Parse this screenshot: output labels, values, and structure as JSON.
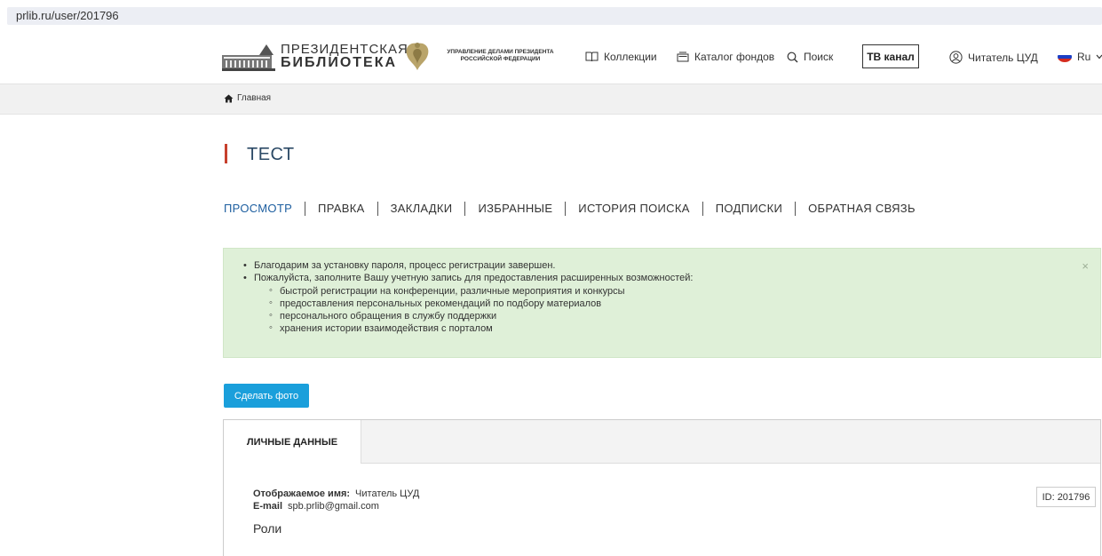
{
  "browser": {
    "url": "prlib.ru/user/201796"
  },
  "header": {
    "logo_line1": "ПРЕЗИДЕНТСКАЯ",
    "logo_line2": "БИБЛИОТЕКА",
    "admin_line1": "УПРАВЛЕНИЕ ДЕЛАМИ ПРЕЗИДЕНТА",
    "admin_line2": "РОССИЙСКОЙ ФЕДЕРАЦИИ",
    "nav": {
      "collections": "Коллекции",
      "catalog": "Каталог фондов",
      "search": "Поиск",
      "tv": "ТВ канал",
      "user": "Читатель ЦУД",
      "lang": "Ru"
    }
  },
  "breadcrumb": {
    "home": "Главная"
  },
  "page": {
    "title": "ТЕСТ"
  },
  "tabs": [
    "ПРОСМОТР",
    "ПРАВКА",
    "ЗАКЛАДКИ",
    "ИЗБРАННЫЕ",
    "ИСТОРИЯ ПОИСКА",
    "ПОДПИСКИ",
    "ОБРАТНАЯ СВЯЗЬ"
  ],
  "alert": {
    "items": [
      "Благодарим за установку пароля, процесс регистрации завершен.",
      "Пожалуйста, заполните Вашу учетную запись для предоставления расширенных возможностей:"
    ],
    "subitems": [
      "быстрой регистрации на конференции, различные мероприятия и конкурсы",
      "предоставления персональных рекомендаций по подбору материалов",
      "персонального обращения в службу поддержки",
      "хранения истории взаимодействия с порталом"
    ],
    "close": "×"
  },
  "photo_button": "Сделать фото",
  "profile": {
    "tab": "ЛИЧНЫЕ ДАННЫЕ",
    "display_name_label": "Отображаемое имя:",
    "display_name": "Читатель ЦУД",
    "email_label": "E-mail",
    "email": "spb.prlib@gmail.com",
    "roles": "Роли",
    "id": "ID: 201796"
  },
  "colors": {
    "accent_blue": "#1a9fdb",
    "title_red": "#c7402d",
    "alert_green": "#dff0d8"
  },
  "icons": [
    "book-icon",
    "catalog-icon",
    "search-icon",
    "user-icon",
    "flag-icon",
    "home-icon",
    "close-icon"
  ]
}
